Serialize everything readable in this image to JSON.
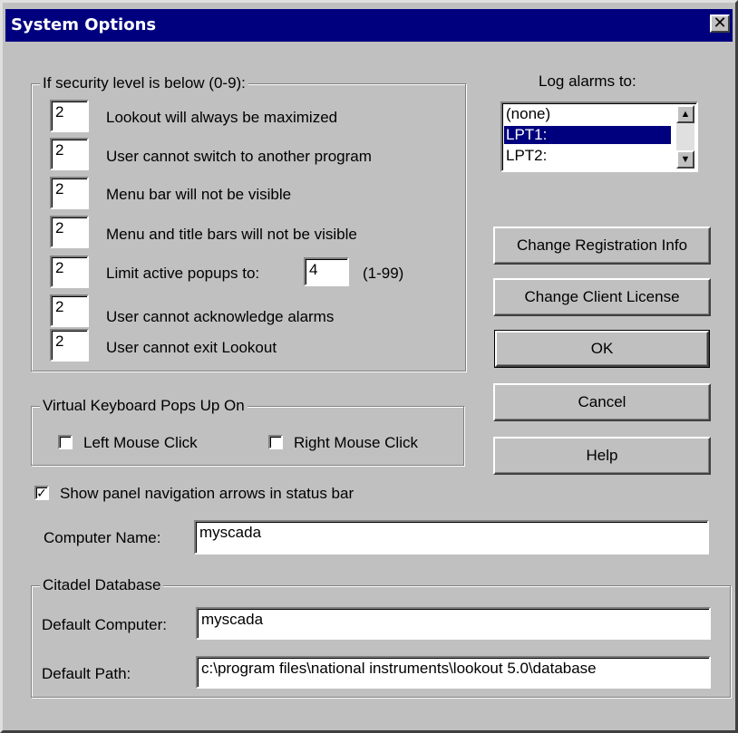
{
  "window": {
    "title": "System Options",
    "close_glyph": "✕"
  },
  "security": {
    "group_label": "If security level is below (0-9):",
    "rows": [
      {
        "value": "2",
        "label": "Lookout will always be maximized"
      },
      {
        "value": "2",
        "label": "User cannot switch to another program"
      },
      {
        "value": "2",
        "label": "Menu bar will not be visible"
      },
      {
        "value": "2",
        "label": "Menu and title bars will not be visible"
      },
      {
        "value": "2",
        "label": "Limit active popups to:"
      },
      {
        "value": "2",
        "label": "User cannot acknowledge alarms"
      },
      {
        "value": "2",
        "label": "User cannot exit Lookout"
      }
    ],
    "popups_value": "4",
    "popups_range": "(1-99)"
  },
  "log_alarms": {
    "label": "Log alarms to:",
    "items": [
      "(none)",
      "LPT1:",
      "LPT2:"
    ],
    "selected": "LPT1:"
  },
  "buttons": {
    "change_registration": "Change Registration Info",
    "change_client_license": "Change Client License",
    "ok": "OK",
    "cancel": "Cancel",
    "help": "Help"
  },
  "virtual_keyboard": {
    "group_label": "Virtual Keyboard Pops Up On",
    "left_click": {
      "label": "Left Mouse Click",
      "checked": false
    },
    "right_click": {
      "label": "Right Mouse Click",
      "checked": false
    }
  },
  "show_nav_arrows": {
    "label": "Show panel navigation arrows in status bar",
    "checked": true,
    "check_glyph": "✓"
  },
  "computer_name": {
    "label": "Computer Name:",
    "value": "myscada"
  },
  "citadel": {
    "group_label": "Citadel Database",
    "default_computer_label": "Default Computer:",
    "default_computer_value": "myscada",
    "default_path_label": "Default Path:",
    "default_path_value": "c:\\program files\\national instruments\\lookout 5.0\\database"
  }
}
